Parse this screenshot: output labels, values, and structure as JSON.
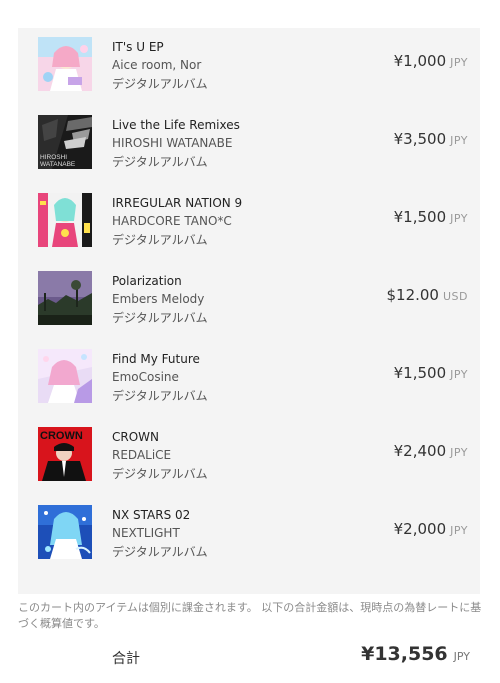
{
  "cart": {
    "items": [
      {
        "title": "IT's U EP",
        "artist": "Aice room, Nor",
        "type": "デジタルアルバム",
        "price": "¥1,000",
        "currency": "JPY",
        "cover_colors": [
          "#f7d6e8",
          "#9fd3f5"
        ]
      },
      {
        "title": "Live the Life Remixes",
        "artist": "HIROSHI WATANABE",
        "type": "デジタルアルバム",
        "price": "¥3,500",
        "currency": "JPY",
        "cover_text": [
          "HIROSHI",
          "WATANABE"
        ],
        "cover_colors": [
          "#1a1a1a",
          "#cfcfcf"
        ]
      },
      {
        "title": "IRREGULAR NATION 9",
        "artist": "HARDCORE TANO*C",
        "type": "デジタルアルバム",
        "price": "¥1,500",
        "currency": "JPY",
        "cover_colors": [
          "#f2f2f2",
          "#e8457b"
        ]
      },
      {
        "title": "Polarization",
        "artist": "Embers Melody",
        "type": "デジタルアルバム",
        "price": "$12.00",
        "currency": "USD",
        "cover_colors": [
          "#6b5a8c",
          "#2b3a2a"
        ]
      },
      {
        "title": "Find My Future",
        "artist": "EmoCosine",
        "type": "デジタルアルバム",
        "price": "¥1,500",
        "currency": "JPY",
        "cover_colors": [
          "#e9dcf5",
          "#f2a8cf"
        ]
      },
      {
        "title": "CROWN",
        "artist": "REDALiCE",
        "type": "デジタルアルバム",
        "price": "¥2,400",
        "currency": "JPY",
        "cover_text": [
          "CROWN"
        ],
        "cover_colors": [
          "#d8141c",
          "#111111"
        ]
      },
      {
        "title": "NX STARS 02",
        "artist": "NEXTLIGHT",
        "type": "デジタルアルバム",
        "price": "¥2,000",
        "currency": "JPY",
        "cover_colors": [
          "#1d4fb8",
          "#7fd6f5"
        ]
      }
    ]
  },
  "note": "このカート内のアイテムは個別に課金されます。 以下の合計金額は、現時点の為替レートに基づく概算値です。",
  "total": {
    "label": "合計",
    "amount": "¥13,556",
    "currency": "JPY"
  }
}
